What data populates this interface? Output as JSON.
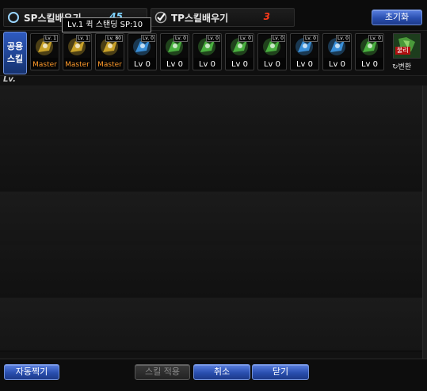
{
  "tabs": {
    "sp": {
      "label": "SP스킬배우기",
      "count": "45",
      "icon": "circle-icon"
    },
    "tp": {
      "label": "TP스킬배우기",
      "count": "3",
      "icon": "checkmark-icon"
    }
  },
  "reset_button": "초기화",
  "tooltip": "Lv.1 퀵 스탠딩 SP:10",
  "common_label": {
    "line1": "공용",
    "line2": "스킬"
  },
  "skills": [
    {
      "icon": "rising-strike-skill-icon",
      "badge": "Lv. 1",
      "level": "Master",
      "color": "#c9a22a"
    },
    {
      "icon": "quick-standing-skill-icon",
      "badge": "Lv. 1",
      "level": "Master",
      "color": "#c9a22a"
    },
    {
      "icon": "backstep-skill-icon",
      "badge": "Lv. 80",
      "level": "Master",
      "color": "#c9a22a"
    },
    {
      "icon": "wing-skill-icon",
      "badge": "Lv. 0",
      "level": "Lv 0",
      "color": "#3a8fd8"
    },
    {
      "icon": "target-skill-icon",
      "badge": "Lv. 0",
      "level": "Lv 0",
      "color": "#4ab040"
    },
    {
      "icon": "target-skill-icon",
      "badge": "Lv. 0",
      "level": "Lv 0",
      "color": "#4ab040"
    },
    {
      "icon": "fighter-skill-icon",
      "badge": "Lv. 0",
      "level": "Lv 0",
      "color": "#4ab040"
    },
    {
      "icon": "fighter-skill-icon",
      "badge": "Lv. 0",
      "level": "Lv 0",
      "color": "#4ab040"
    },
    {
      "icon": "eye-skill-icon",
      "badge": "Lv. 0",
      "level": "Lv 0",
      "color": "#3a8fd8"
    },
    {
      "icon": "armor-skill-icon",
      "badge": "Lv. 0",
      "level": "Lv 0",
      "color": "#3a8fd8"
    },
    {
      "icon": "dragon-skill-icon",
      "badge": "Lv. 0",
      "level": "Lv 0",
      "color": "#4ab040"
    }
  ],
  "convert": {
    "badge": "물리",
    "label": "변환"
  },
  "lv_label": "Lv.",
  "buttons": {
    "auto": "자동찍기",
    "apply": "스킬 적용",
    "cancel": "취소",
    "close": "닫기"
  }
}
